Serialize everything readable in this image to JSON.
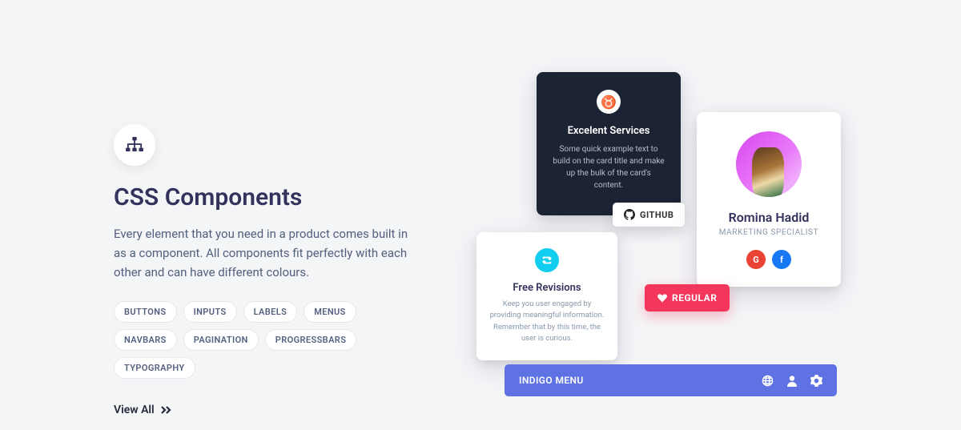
{
  "left": {
    "heading": "CSS Components",
    "description": "Every element that you need in a product comes built in as a component. All components fit perfectly with each other and can have different colours.",
    "pills": [
      "BUTTONS",
      "INPUTS",
      "LABELS",
      "MENUS",
      "NAVBARS",
      "PAGINATION",
      "PROGRESSBARS",
      "TYPOGRAPHY"
    ],
    "view_all": "View All"
  },
  "dark_card": {
    "title": "Excelent Services",
    "body": "Some quick example text to build on the card title and make up the bulk of the card's content."
  },
  "github_button": "GITHUB",
  "profile_card": {
    "name": "Romina Hadid",
    "role": "MARKETING SPECIALIST",
    "google_label": "G",
    "facebook_label": "f"
  },
  "revisions_card": {
    "title": "Free Revisions",
    "body": "Keep you user engaged by providing meaningful information. Remember that by this time, the user is curious."
  },
  "regular_button": "REGULAR",
  "menu_bar": {
    "label": "INDIGO MENU"
  }
}
